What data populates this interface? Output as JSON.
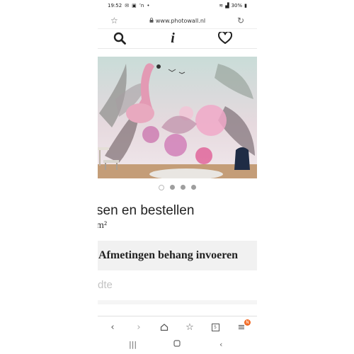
{
  "status": {
    "time": "19:52",
    "battery": "30%"
  },
  "browser": {
    "url": "www.photowall.nl"
  },
  "toolbar": {
    "icons": [
      "search-icon",
      "info-icon",
      "heart-icon"
    ]
  },
  "carousel": {
    "slide_count": 4,
    "active_index": 0
  },
  "product": {
    "heading": "sen en bestellen",
    "subheading": "m²",
    "dimensions_button": "Afmetingen behang invoeren",
    "faded_field": "dte"
  },
  "browser_nav": {
    "tabs_count": "5",
    "menu_badge": "N"
  },
  "colors": {
    "accent": "#f26a24",
    "button_bg": "#f1f1f1"
  }
}
